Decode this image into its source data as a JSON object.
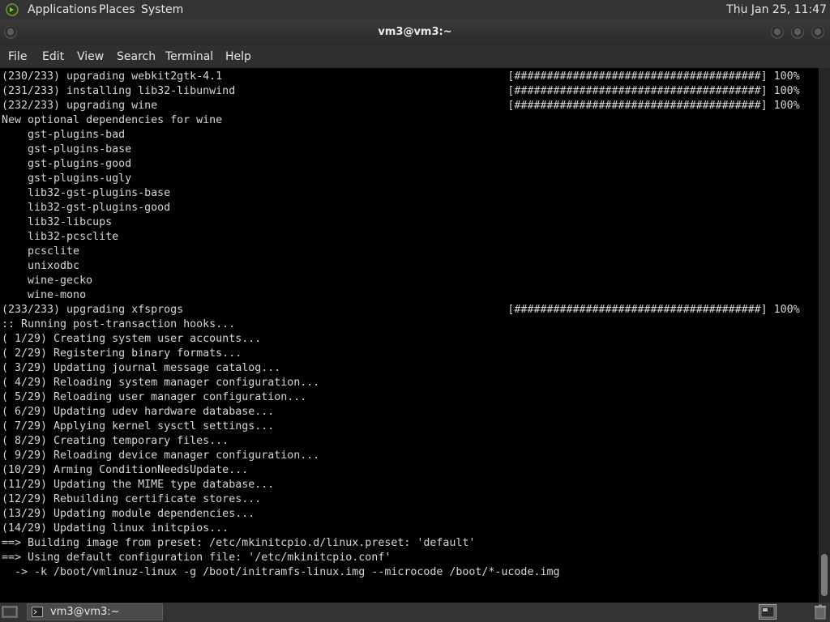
{
  "top_panel": {
    "menus": [
      "Applications",
      "Places",
      "System"
    ],
    "clock": "Thu Jan 25, 11:47"
  },
  "window": {
    "title": "vm3@vm3:~"
  },
  "menubar": [
    "File",
    "Edit",
    "View",
    "Search",
    "Terminal",
    "Help"
  ],
  "terminal": {
    "lines": [
      "(230/233) upgrading webkit2gtk-4.1                                            [######################################] 100%",
      "(231/233) installing lib32-libunwind                                          [######################################] 100%",
      "(232/233) upgrading wine                                                      [######################################] 100%",
      "New optional dependencies for wine",
      "    gst-plugins-bad",
      "    gst-plugins-base",
      "    gst-plugins-good",
      "    gst-plugins-ugly",
      "    lib32-gst-plugins-base",
      "    lib32-gst-plugins-good",
      "    lib32-libcups",
      "    lib32-pcsclite",
      "    pcsclite",
      "    unixodbc",
      "    wine-gecko",
      "    wine-mono",
      "(233/233) upgrading xfsprogs                                                  [######################################] 100%",
      ":: Running post-transaction hooks...",
      "( 1/29) Creating system user accounts...",
      "( 2/29) Registering binary formats...",
      "( 3/29) Updating journal message catalog...",
      "( 4/29) Reloading system manager configuration...",
      "( 5/29) Reloading user manager configuration...",
      "( 6/29) Updating udev hardware database...",
      "( 7/29) Applying kernel sysctl settings...",
      "( 8/29) Creating temporary files...",
      "( 9/29) Reloading device manager configuration...",
      "(10/29) Arming ConditionNeedsUpdate...",
      "(11/29) Updating the MIME type database...",
      "(12/29) Rebuilding certificate stores...",
      "(13/29) Updating module dependencies...",
      "(14/29) Updating linux initcpios...",
      "==> Building image from preset: /etc/mkinitcpio.d/linux.preset: 'default'",
      "==> Using default configuration file: '/etc/mkinitcpio.conf'",
      "  -> -k /boot/vmlinuz-linux -g /boot/initramfs-linux.img --microcode /boot/*-ucode.img"
    ]
  },
  "taskbar": {
    "task_label": "vm3@vm3:~"
  },
  "colors": {
    "terminal_bg": "#000000",
    "terminal_fg": "#d6d6d6",
    "panel_bg": "#333333",
    "distro_accent": "#6a9b3b"
  },
  "icons": [
    "distro-logo-icon",
    "minimize-icon",
    "maximize-icon",
    "close-icon",
    "show-desktop-icon",
    "terminal-icon",
    "workspace-icon",
    "trash-icon"
  ]
}
